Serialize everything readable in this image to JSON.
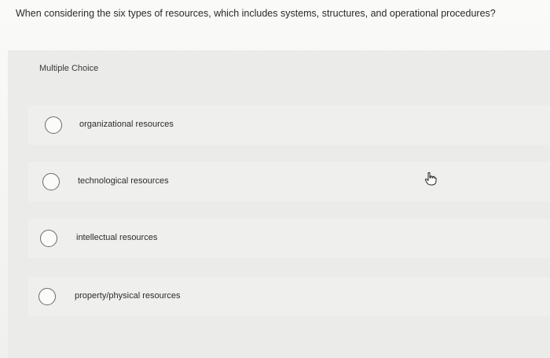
{
  "question": {
    "text": "When considering the six types of resources, which includes systems, structures, and operational procedures?"
  },
  "quiz": {
    "type_label": "Multiple Choice",
    "choices": [
      {
        "label": "organizational resources",
        "selected": false
      },
      {
        "label": "technological resources",
        "selected": false
      },
      {
        "label": "intellectual resources",
        "selected": false
      },
      {
        "label": "property/physical resources",
        "selected": false
      }
    ]
  },
  "icons": {
    "cursor": "hand-pointer-icon",
    "radio": "radio-empty-icon"
  },
  "colors": {
    "background": "#f7f7f6",
    "panel": "#ebebea",
    "choice_row": "#efefee",
    "radio_border": "#6a6a6a",
    "text": "#2b2b2b"
  }
}
